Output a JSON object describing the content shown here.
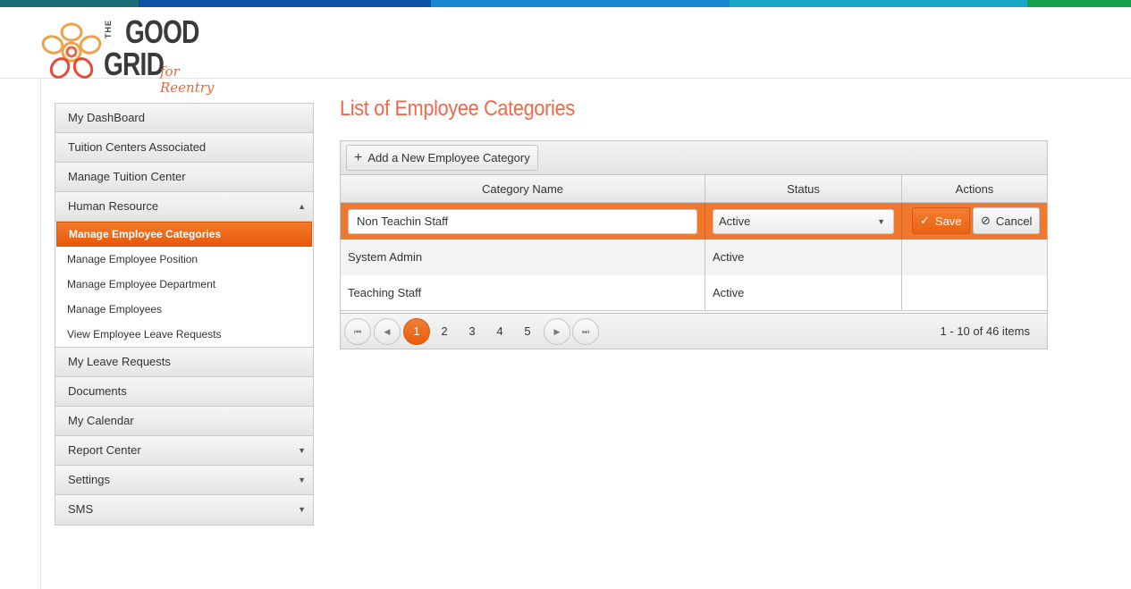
{
  "colors": {
    "topbar": [
      "#1a6e7a",
      "#0a52a8",
      "#1a86d6",
      "#19a4c8",
      "#13a14c"
    ],
    "accent": "#f0782e",
    "title": "#f0674a"
  },
  "logo": {
    "the": "THE",
    "good": "GOOD",
    "grid": "GRID",
    "tagline": "for Reentry"
  },
  "sidebar": {
    "items_top": [
      {
        "label": "My DashBoard"
      },
      {
        "label": "Tuition Centers Associated"
      },
      {
        "label": "Manage Tuition Center"
      }
    ],
    "expanded": {
      "label": "Human Resource",
      "arrow": "▲"
    },
    "sub_items": [
      {
        "label": "Manage Employee Categories"
      },
      {
        "label": "Manage Employee Position"
      },
      {
        "label": "Manage Employee Department"
      },
      {
        "label": "Manage Employees"
      },
      {
        "label": "View Employee Leave Requests"
      }
    ],
    "items_bottom": [
      {
        "label": "My Leave Requests",
        "arrow": ""
      },
      {
        "label": "Documents",
        "arrow": ""
      },
      {
        "label": "My Calendar",
        "arrow": ""
      },
      {
        "label": "Report Center",
        "arrow": "▼"
      },
      {
        "label": "Settings",
        "arrow": "▼"
      },
      {
        "label": "SMS",
        "arrow": "▼"
      }
    ]
  },
  "main": {
    "title": "List of Employee Categories",
    "add_button": "Add a New Employee Category",
    "columns": [
      "Category Name",
      "Status",
      "Actions"
    ],
    "edit_row": {
      "name_value": "Non Teachin Staff",
      "status_value": "Active",
      "save_label": "Save",
      "cancel_label": "Cancel"
    },
    "rows": [
      {
        "name": "System Admin",
        "status": "Active"
      },
      {
        "name": "Teaching Staff",
        "status": "Active"
      }
    ],
    "pager": {
      "pages": [
        "1",
        "2",
        "3",
        "4",
        "5"
      ],
      "current": "1",
      "info": "1 - 10 of 46 items"
    }
  }
}
